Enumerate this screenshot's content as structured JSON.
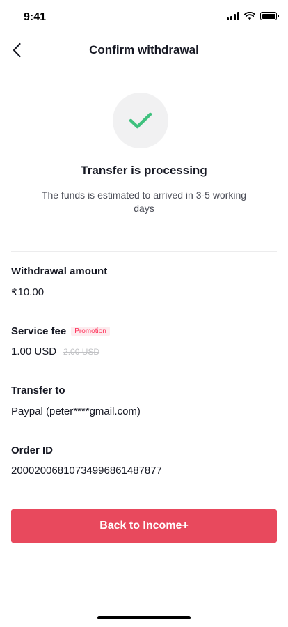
{
  "status_bar": {
    "time": "9:41"
  },
  "nav": {
    "title": "Confirm withdrawal"
  },
  "result": {
    "title": "Transfer is processing",
    "description": "The funds is estimated to arrived in 3-5 working days"
  },
  "details": {
    "withdrawal_amount": {
      "label": "Withdrawal amount",
      "value": "₹10.00"
    },
    "service_fee": {
      "label": "Service fee",
      "badge": "Promotion",
      "value": "1.00 USD",
      "original_value": "2.00 USD"
    },
    "transfer_to": {
      "label": "Transfer to",
      "value": "Paypal (peter****gmail.com)"
    },
    "order_id": {
      "label": "Order ID",
      "value": "20002006810734996861487877"
    }
  },
  "actions": {
    "back_label": "Back to Income+"
  },
  "colors": {
    "primary": "#e8495d",
    "success": "#3fc17e",
    "badge_text": "#fe2c55",
    "badge_bg": "#fdecef"
  },
  "icons": {
    "back": "chevron-left-icon",
    "success": "checkmark-icon"
  }
}
